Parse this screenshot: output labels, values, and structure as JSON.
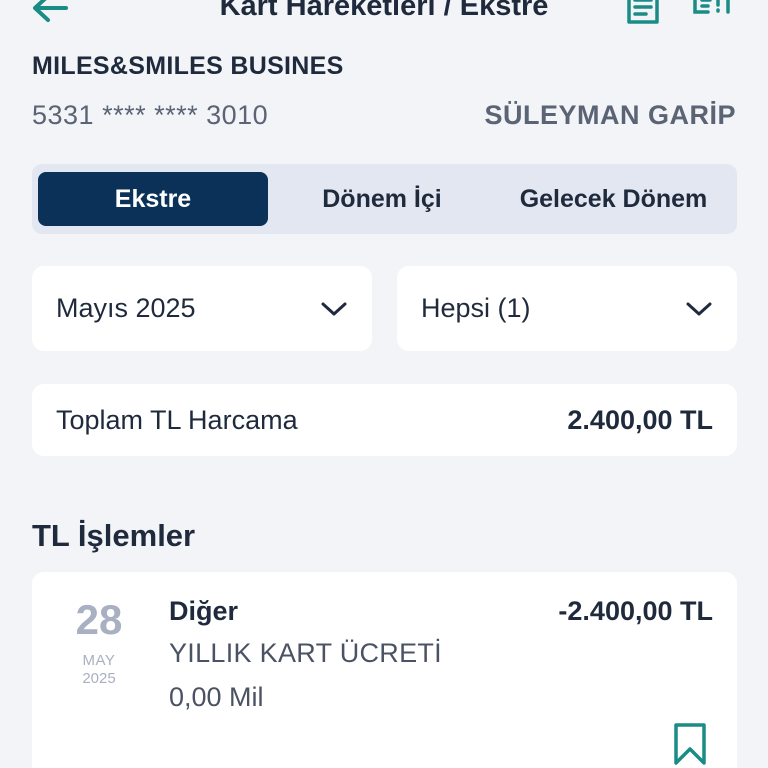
{
  "header": {
    "title": "Kart Hareketleri / Ekstre"
  },
  "card": {
    "name": "MILES&SMILES BUSINES",
    "number": "5331 **** **** 3010",
    "holder": "SÜLEYMAN GARİP"
  },
  "tabs": [
    {
      "label": "Ekstre",
      "active": true
    },
    {
      "label": "Dönem İçi",
      "active": false
    },
    {
      "label": "Gelecek Dönem",
      "active": false
    }
  ],
  "filters": {
    "period": "Mayıs 2025",
    "type": "Hepsi (1)"
  },
  "summary": {
    "label": "Toplam TL Harcama",
    "value": "2.400,00 TL"
  },
  "transactions": {
    "section_title": "TL İşlemler",
    "items": [
      {
        "day": "28",
        "month": "MAY",
        "year": "2025",
        "category": "Diğer",
        "description": "YILLIK KART ÜCRETİ",
        "miles": "0,00 Mil",
        "amount": "-2.400,00 TL"
      }
    ]
  },
  "colors": {
    "primary": "#0b3158",
    "accent": "#1a8c86",
    "background": "#f2f4f8"
  }
}
